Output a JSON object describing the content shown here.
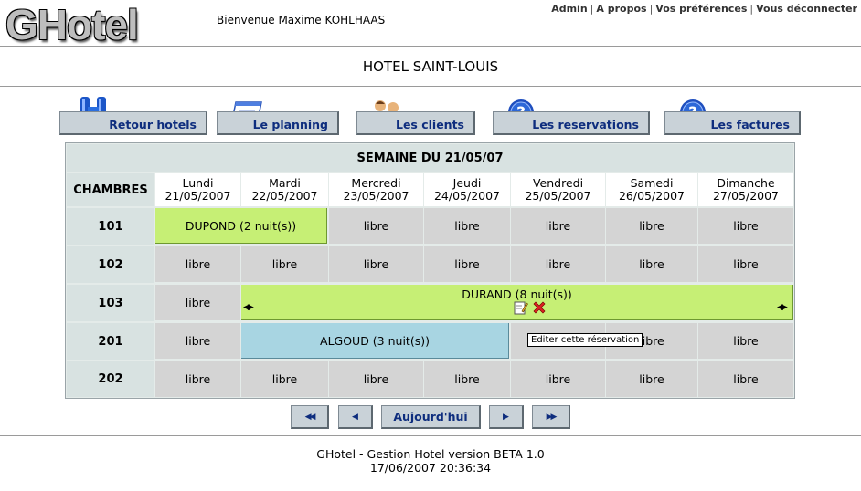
{
  "header": {
    "logo": "GHotel",
    "welcome": "Bienvenue Maxime KOHLHAAS",
    "links": [
      "Admin",
      "A propos",
      "Vos préférences",
      "Vous déconnecter"
    ]
  },
  "hotel_name": "HOTEL SAINT-LOUIS",
  "nav": [
    {
      "label": "Retour hotels",
      "icon": "hotel-h-icon"
    },
    {
      "label": "Le planning",
      "icon": "planning-card-icon"
    },
    {
      "label": "Les clients",
      "icon": "clients-people-icon"
    },
    {
      "label": "Les reservations",
      "icon": "help-question-icon"
    },
    {
      "label": "Les factures",
      "icon": "help-question-icon"
    }
  ],
  "planning": {
    "week_title": "SEMAINE DU 21/05/07",
    "rooms_header": "CHAMBRES",
    "days": [
      {
        "name": "Lundi",
        "date": "21/05/2007"
      },
      {
        "name": "Mardi",
        "date": "22/05/2007"
      },
      {
        "name": "Mercredi",
        "date": "23/05/2007"
      },
      {
        "name": "Jeudi",
        "date": "24/05/2007"
      },
      {
        "name": "Vendredi",
        "date": "25/05/2007"
      },
      {
        "name": "Samedi",
        "date": "26/05/2007"
      },
      {
        "name": "Dimanche",
        "date": "27/05/2007"
      }
    ],
    "rooms": [
      "101",
      "102",
      "103",
      "201",
      "202"
    ],
    "free_label": "libre",
    "reservations": {
      "dupond": "DUPOND (2 nuit(s))",
      "durand": "DURAND (8 nuit(s))",
      "algoud": "ALGOUD (3 nuit(s))"
    },
    "tooltip": "Editer cette réservation"
  },
  "pager": {
    "first": "◀◀",
    "prev": "◀",
    "today": "Aujourd'hui",
    "next": "▶",
    "last": "▶▶"
  },
  "footer": {
    "line1": "GHotel - Gestion Hotel version BETA 1.0",
    "line2": "17/06/2007 20:36:34"
  },
  "colors": {
    "reservation_green": "#c6ef75",
    "reservation_blue": "#a8d5e2",
    "free_cell": "#d4d4d4",
    "button_text": "#0e2d7e"
  }
}
